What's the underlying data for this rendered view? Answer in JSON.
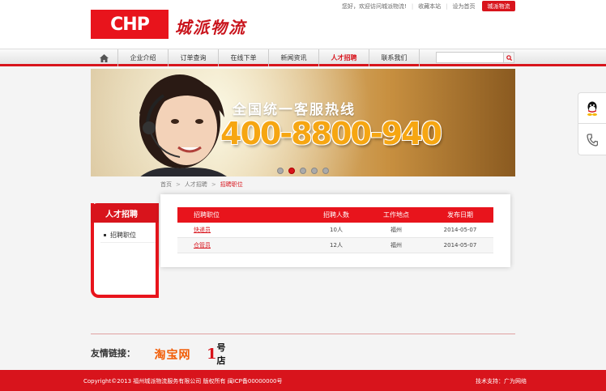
{
  "header": {
    "logo_text": "CHP",
    "brand_name": "城派物流",
    "greeting": "您好，欢迎访问城派物流!",
    "bookmark": "收藏本站",
    "set_home": "设为首页",
    "top_button": "城派物流"
  },
  "nav": {
    "home_icon": "home-icon",
    "items": [
      {
        "label": "企业介绍",
        "width": 62
      },
      {
        "label": "订单查询",
        "width": 62
      },
      {
        "label": "在线下单",
        "width": 62
      },
      {
        "label": "新闻资讯",
        "width": 62
      },
      {
        "label": "人才招聘",
        "width": 62
      },
      {
        "label": "联系我们",
        "width": 62
      }
    ],
    "active_index": 4,
    "search": {
      "placeholder": "",
      "icon": "search-icon"
    }
  },
  "banner": {
    "hotline_label": "全国统一客服热线",
    "phone": "400-8800-940",
    "slides": 5,
    "active_slide": 1
  },
  "float": {
    "qq_icon": "qq-icon",
    "phone_icon": "phone-icon"
  },
  "breadcrumb": {
    "items": [
      "首页",
      "人才招聘",
      "招聘职位"
    ]
  },
  "sidebar": {
    "title": "人才招聘",
    "items": [
      "招聘职位"
    ]
  },
  "jobs": {
    "headers": [
      "招聘职位",
      "招聘人数",
      "工作地点",
      "发布日期"
    ],
    "rows": [
      [
        "快递员",
        "10人",
        "福州",
        "2014-05-07"
      ],
      [
        "仓管员",
        "12人",
        "福州",
        "2014-05-07"
      ]
    ]
  },
  "links": {
    "label": "友情链接：",
    "taobao": "淘宝网",
    "yhd_1": "1",
    "yhd_rest": "号店"
  },
  "footer": {
    "copyright": "Copyright©2013 福州城派物流服务有限公司 版权所有 闽ICP备00000000号",
    "support": "技术支持：广为网络"
  },
  "colors": {
    "brand_red": "#d8141c",
    "phone_orange": "#f6a612"
  }
}
